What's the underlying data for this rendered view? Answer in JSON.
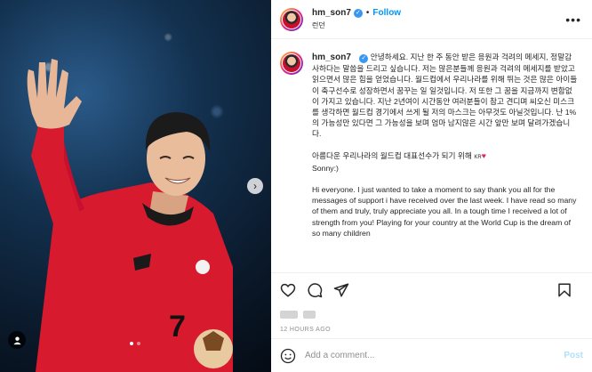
{
  "post": {
    "username": "hm_son7",
    "separator": "•",
    "follow_label": "Follow",
    "location": "런던",
    "caption_korean": "안녕하세요. 지난 한 주 동안 받은 응원과 걱려의 메세지, 정말감사하다는 말씀을 드리고 싶습니다. 저는 많은분들께 응원과 걱려의 메세지를 받았고 읽으면서 많은 힘을 얻었습니다. 월드컵에서 우리나라를 위해 뛰는 것은 많은 아이들이 축구선수로 성장하면서 꿈꾸는 일 일것입니다. 저 또한 그 꿈을 지금까지 변함없이 가지고 있습니다. 지난 2년여이 시간동안 여러분들이 참고 견디며 씨오신 미스크를 생각하면 월드컵 경기에서 쓰게 될 저의 마스크는 아무것도 아닐것입니다. 난 1%의 가능성만 있다면 그 가능성을 보며 엄마 남지않은 시간 앞만 보며 달려가겠습니다.",
    "caption_korean_2a": "아름다운 우리나라의 월드컵 대표선수가 되기 위해",
    "caption_flag": "KR",
    "caption_heart": "♥",
    "caption_korean_2b": "Sonny:)",
    "caption_english": "Hi everyone. I just wanted to take a moment to say thank you all for the messages of support i have received over the last week. I have read so many of them and truly, truly appreciate you all. In a tough time I received a lot of strength from you! Playing for your country at the World Cup is the dream of so many children",
    "timestamp": "12 HOURS AGO",
    "comment_placeholder": "Add a comment...",
    "post_label": "Post",
    "carousel": {
      "count": 2,
      "active_index": 1
    }
  },
  "icons": {
    "verified": "verified-badge-icon",
    "more": "more-options-icon",
    "next": "chevron-right-icon",
    "tag": "user-tag-icon",
    "like": "heart-icon",
    "comment": "comment-icon",
    "share": "share-icon",
    "save": "bookmark-icon",
    "emoji": "emoji-icon"
  },
  "colors": {
    "accent": "#0095f6",
    "post_disabled": "#b2dffc",
    "verified": "#3897f0",
    "jersey": "#d71a2e"
  }
}
